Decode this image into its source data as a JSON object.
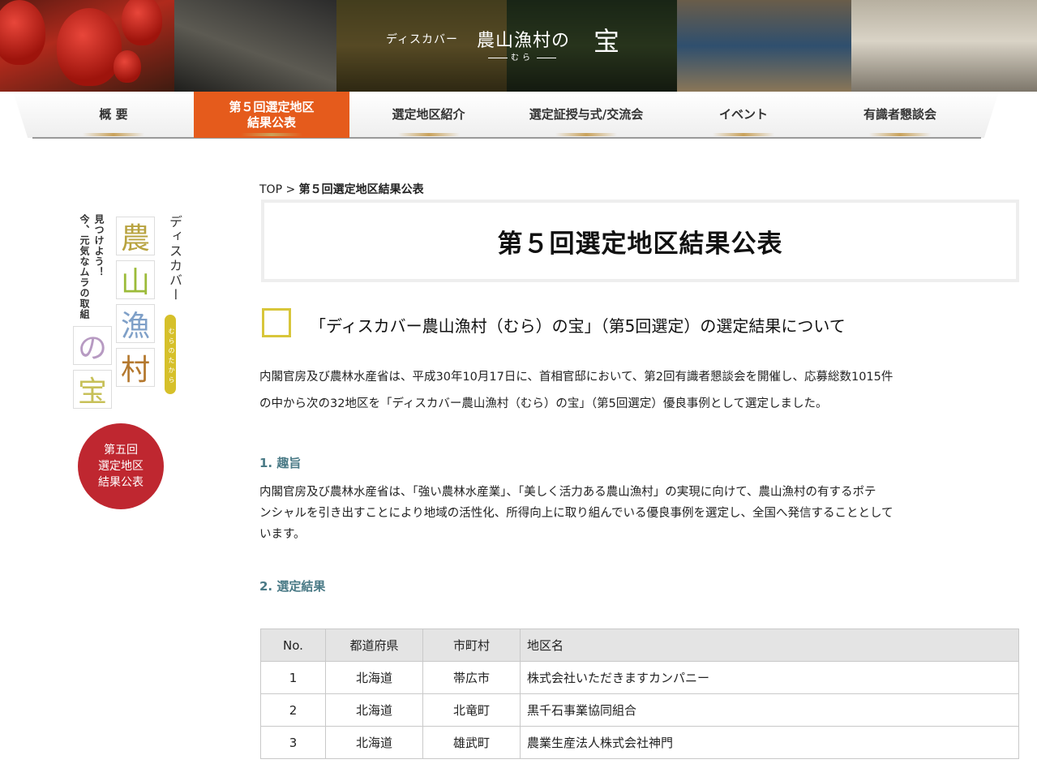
{
  "banner": {
    "brand_pre": "ディスカバー",
    "brand_main": "農山漁村の",
    "brand_big": "宝",
    "brand_ruby": "むら"
  },
  "nav": {
    "items": [
      {
        "label": "概 要"
      },
      {
        "label": "第５回選定地区\n結果公表",
        "active": true
      },
      {
        "label": "選定地区紹介"
      },
      {
        "label": "選定証授与式/交流会"
      },
      {
        "label": "イベント"
      },
      {
        "label": "有識者懇談会"
      }
    ],
    "active_color": "#e55b1c"
  },
  "sidebar": {
    "tagline_1": "見つけよう！",
    "tagline_2": "今、元気なムラの取組",
    "discover": "ディスカバー",
    "mura_pill": "むらのたから",
    "kanji": [
      "農",
      "山",
      "漁",
      "村",
      "の",
      "宝"
    ],
    "badge_lines": [
      "第五回",
      "選定地区",
      "結果公表"
    ],
    "badge_color": "#bf2730"
  },
  "breadcrumb": {
    "top": "TOP",
    "separator": " > ",
    "current": "第５回選定地区結果公表"
  },
  "page_title": "第５回選定地区結果公表",
  "section_title": "「ディスカバー農山漁村（むら）の宝」（第5回選定）の選定結果について",
  "intro": [
    "内閣官房及び農林水産省は、平成30年10月17日に、首相官邸において、第2回有識者懇談会を開催し、応募総数1015件",
    "の中から次の32地区を「ディスカバー農山漁村（むら）の宝」（第5回選定）優良事例として選定しました。"
  ],
  "section1": {
    "heading": "1. 趣旨",
    "lines": [
      "内閣官房及び農林水産省は、「強い農林水産業」、「美しく活力ある農山漁村」の実現に向けて、農山漁村の有するポテ",
      "ンシャルを引き出すことにより地域の活性化、所得向上に取り組んでいる優良事例を選定し、全国へ発信することとして",
      "います。"
    ]
  },
  "section2": {
    "heading": "2. 選定結果"
  },
  "table": {
    "headers": [
      "No.",
      "都道府県",
      "市町村",
      "地区名"
    ],
    "rows": [
      [
        "1",
        "北海道",
        "帯広市",
        "株式会社いただきますカンパニー"
      ],
      [
        "2",
        "北海道",
        "北竜町",
        "黒千石事業協同組合"
      ],
      [
        "3",
        "北海道",
        "雄武町",
        "農業生産法人株式会社神門"
      ]
    ]
  },
  "colors": {
    "heading_teal": "#4a7a86",
    "section_icon": "#d8c63a"
  }
}
